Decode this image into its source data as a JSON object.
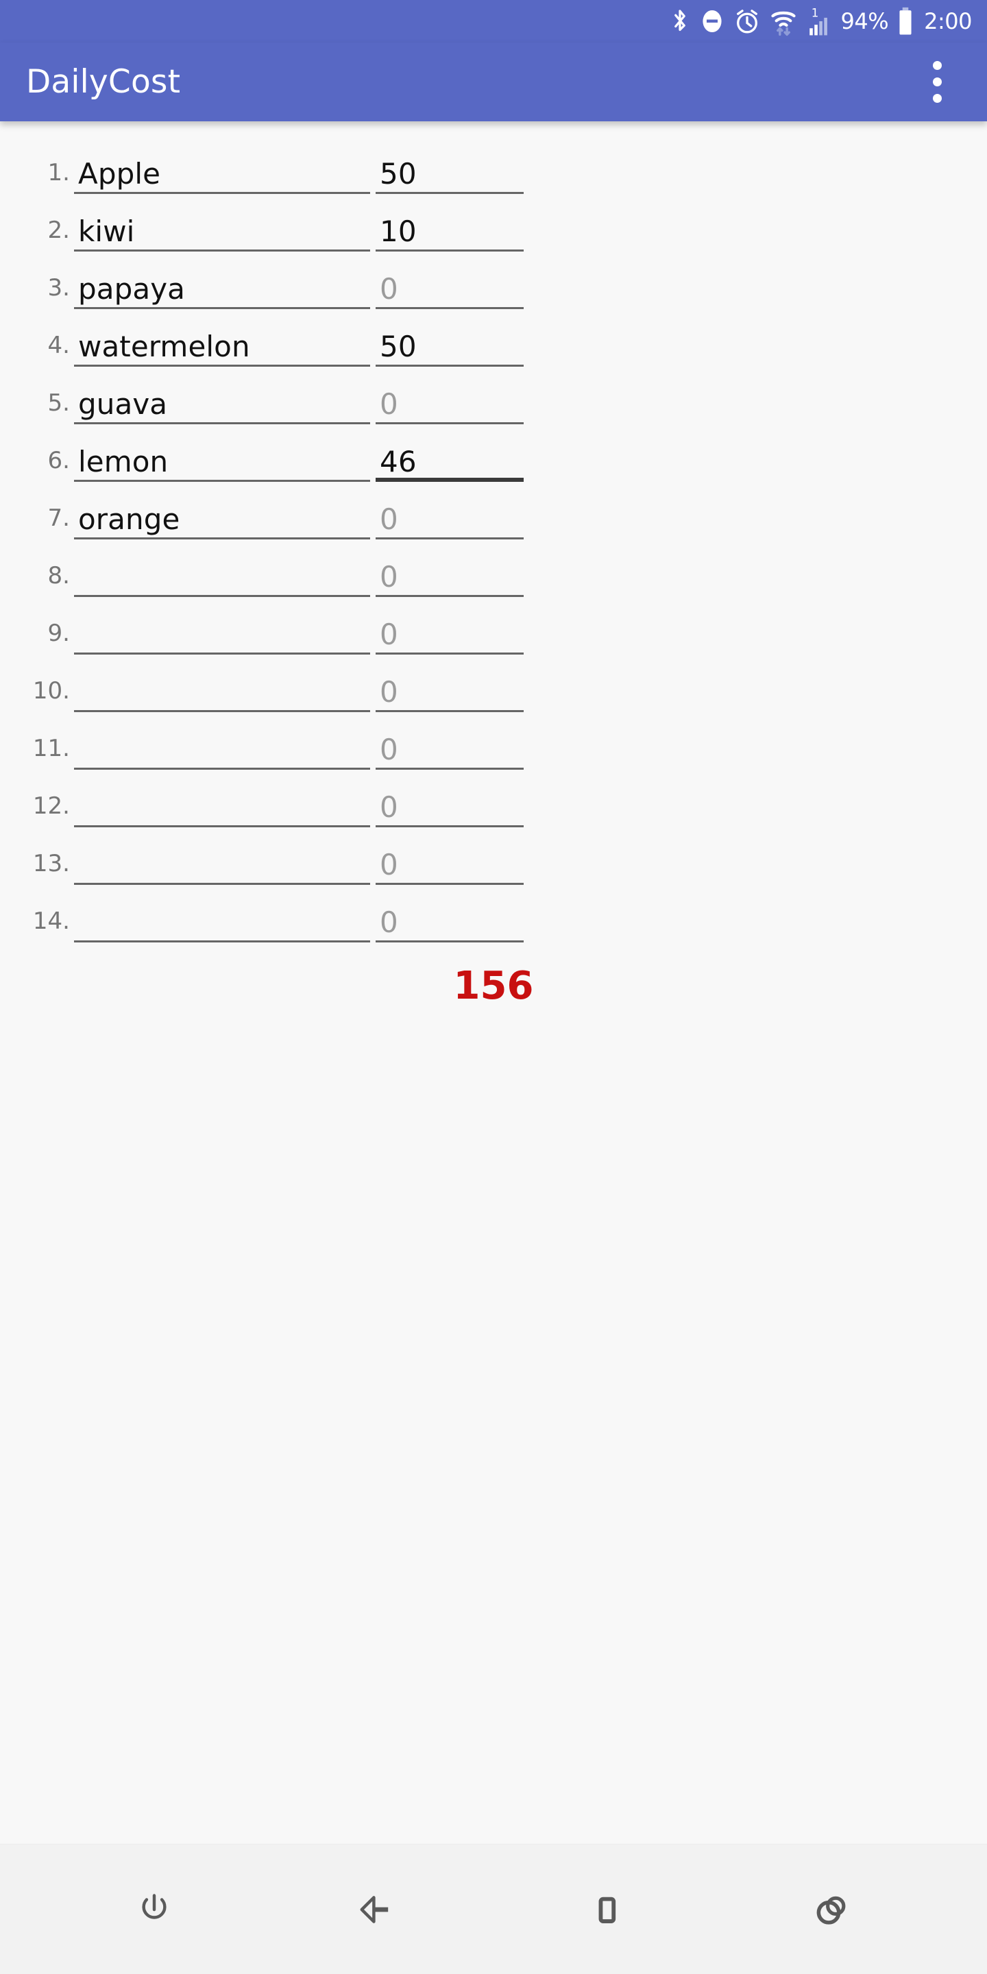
{
  "status_bar": {
    "icons": [
      "bluetooth-icon",
      "do-not-disturb-icon",
      "alarm-icon",
      "wifi-icon",
      "cellular-signal-icon"
    ],
    "sim_label": "1",
    "battery_percent": "94%",
    "clock": "2:00"
  },
  "app_bar": {
    "title": "DailyCost",
    "overflow_menu": "overflow-menu-icon"
  },
  "list": {
    "rows": [
      {
        "index": "1.",
        "name": "Apple",
        "name_is_placeholder": false,
        "value": "50",
        "value_is_placeholder": false,
        "focused": false
      },
      {
        "index": "2.",
        "name": "kiwi",
        "name_is_placeholder": false,
        "value": "10",
        "value_is_placeholder": false,
        "focused": false
      },
      {
        "index": "3.",
        "name": "papaya",
        "name_is_placeholder": false,
        "value": "0",
        "value_is_placeholder": true,
        "focused": false
      },
      {
        "index": "4.",
        "name": "watermelon",
        "name_is_placeholder": false,
        "value": "50",
        "value_is_placeholder": false,
        "focused": false
      },
      {
        "index": "5.",
        "name": "guava",
        "name_is_placeholder": false,
        "value": "0",
        "value_is_placeholder": true,
        "focused": false
      },
      {
        "index": "6.",
        "name": "lemon",
        "name_is_placeholder": false,
        "value": "46",
        "value_is_placeholder": false,
        "focused": true
      },
      {
        "index": "7.",
        "name": "orange",
        "name_is_placeholder": false,
        "value": "0",
        "value_is_placeholder": true,
        "focused": false
      },
      {
        "index": "8.",
        "name": "",
        "name_is_placeholder": true,
        "value": "0",
        "value_is_placeholder": true,
        "focused": false
      },
      {
        "index": "9.",
        "name": "",
        "name_is_placeholder": true,
        "value": "0",
        "value_is_placeholder": true,
        "focused": false
      },
      {
        "index": "10.",
        "name": "",
        "name_is_placeholder": true,
        "value": "0",
        "value_is_placeholder": true,
        "focused": false
      },
      {
        "index": "11.",
        "name": "",
        "name_is_placeholder": true,
        "value": "0",
        "value_is_placeholder": true,
        "focused": false
      },
      {
        "index": "12.",
        "name": "",
        "name_is_placeholder": true,
        "value": "0",
        "value_is_placeholder": true,
        "focused": false
      },
      {
        "index": "13.",
        "name": "",
        "name_is_placeholder": true,
        "value": "0",
        "value_is_placeholder": true,
        "focused": false
      },
      {
        "index": "14.",
        "name": "",
        "name_is_placeholder": true,
        "value": "0",
        "value_is_placeholder": true,
        "focused": false
      }
    ]
  },
  "total": {
    "value": "156",
    "color": "#C81010"
  },
  "nav_bar": {
    "buttons": [
      "power-icon",
      "back-icon",
      "home-icon",
      "recents-icon"
    ]
  },
  "colors": {
    "app_bar": "#5868C4",
    "content_bg": "#f8f8f8",
    "nav_bg": "#f2f2f2",
    "total_red": "#C81010",
    "underline": "#666666",
    "underline_focused": "#3b3b3b"
  }
}
